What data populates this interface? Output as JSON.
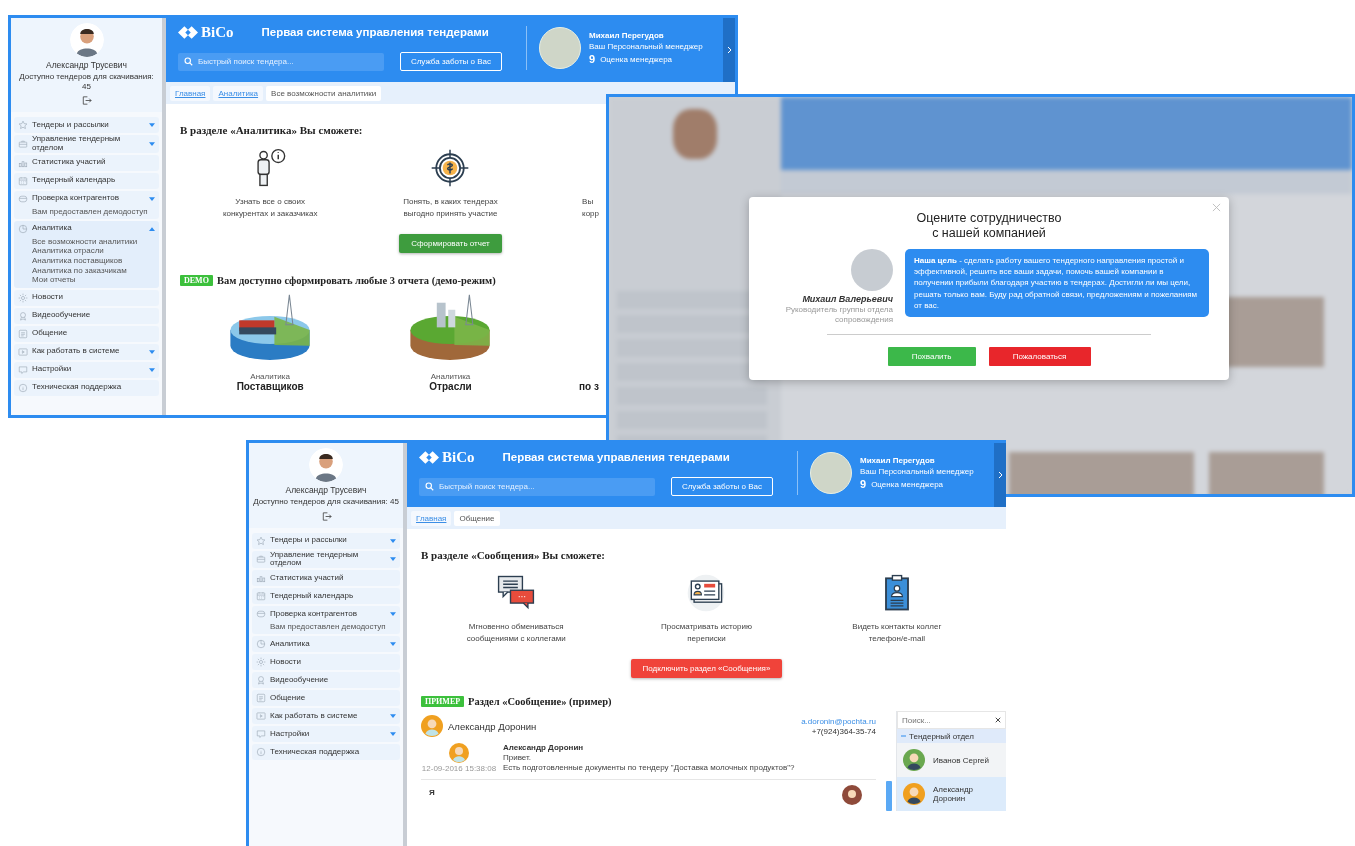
{
  "screens": [
    {
      "kind": "analytics",
      "sidebar": {
        "user_name": "Александр Трусевич",
        "downloads_note": "Доступно тендеров для скачивания: 45",
        "menu": [
          {
            "label": "Тендеры и рассылки",
            "kind": "collapsible",
            "expanded": false
          },
          {
            "label": "Управление тендерным отделом",
            "kind": "collapsible",
            "expanded": false
          },
          {
            "label": "Статистика участий",
            "kind": "plain",
            "expanded": false
          },
          {
            "label": "Тендерный календарь",
            "kind": "plain",
            "expanded": false
          },
          {
            "label": "Проверка контрагентов",
            "kind": "collapsible",
            "expanded": false,
            "note": "Вам предоставлен демодоступ"
          },
          {
            "label": "Аналитика",
            "kind": "collapsible",
            "expanded": true,
            "children": [
              "Все возможности аналитики",
              "Аналитика отрасли",
              "Аналитика поставщиков",
              "Аналитика по заказчикам",
              "Мои отчеты"
            ]
          },
          {
            "label": "Новости",
            "kind": "plain",
            "expanded": false
          },
          {
            "label": "Видеообучение",
            "kind": "plain",
            "expanded": false
          },
          {
            "label": "Общение",
            "kind": "plain",
            "expanded": false
          },
          {
            "label": "Как работать в системе",
            "kind": "collapsible",
            "expanded": false
          },
          {
            "label": "Настройки",
            "kind": "collapsible",
            "expanded": false
          },
          {
            "label": "Техническая поддержка",
            "kind": "plain",
            "expanded": false
          }
        ]
      },
      "header": {
        "logo": "BiCo",
        "title": "Первая система управления тендерами",
        "search": {
          "placeholder": "Быстрый поиск тендера..."
        },
        "care_button": "Служба заботы о Вас",
        "manager": {
          "name": "Михаил Перегудов",
          "role": "Ваш Персональный менеджер",
          "score": "9",
          "score_label": "Оценка менеджера"
        }
      },
      "breadcrumbs": [
        {
          "label": "Главная",
          "selected": false
        },
        {
          "label": "Аналитика",
          "selected": false
        },
        {
          "label": "Все возможности аналитики",
          "selected": true
        }
      ],
      "intro": {
        "heading": "В разделе «Аналитика» Вы сможете:",
        "features": [
          {
            "kind": "full",
            "lines": [
              "Узнать все о своих",
              "конкурентах и заказчиках"
            ]
          },
          {
            "kind": "full",
            "lines": [
              "Понять, в каких тендерах",
              "выгодно принять участие"
            ]
          },
          {
            "kind": "cut",
            "lines": [
              "Вы",
              "корр"
            ]
          }
        ],
        "button": {
          "kind": "green",
          "label": "Сформировать отчет"
        }
      },
      "demo": {
        "badge": "DEMO",
        "heading": "Вам доступно сформировать любые 3 отчета (демо-режим)",
        "reports": [
          {
            "kind": "full",
            "caption": "Аналитика",
            "title": "Поставщиков"
          },
          {
            "kind": "full",
            "caption": "Аналитика",
            "title": "Отрасли"
          },
          {
            "kind": "cut",
            "title": "по з"
          }
        ]
      }
    },
    {
      "kind": "rating",
      "modal": {
        "title_lines": [
          "Оцените сотрудничество",
          "с нашей компанией"
        ],
        "person": {
          "name": "Михаил Валерьевич",
          "role": "Руководитель группы отдела сопровождения"
        },
        "message": "**Наша цель** - сделать работу вашего тендерного направления простой и эффективной, решить все ваши задачи, помочь вашей компании в получении прибыли благодаря участию в тендерах. Достигли ли мы цели, решать только вам. Буду рад обратной связи, предложениям и пожеланиям от вас.",
        "buttons": [
          {
            "kind": "praise",
            "label": "Похвалить"
          },
          {
            "kind": "complain",
            "label": "Пожаловаться"
          }
        ]
      }
    },
    {
      "kind": "messages",
      "sidebar": {
        "user_name": "Александр Трусевич",
        "downloads_note": "Доступно тендеров для скачивания: 45",
        "menu": [
          {
            "label": "Тендеры и рассылки",
            "kind": "collapsible",
            "expanded": false
          },
          {
            "label": "Управление тендерным отделом",
            "kind": "collapsible",
            "expanded": false
          },
          {
            "label": "Статистика участий",
            "kind": "plain",
            "expanded": false
          },
          {
            "label": "Тендерный календарь",
            "kind": "plain",
            "expanded": false
          },
          {
            "label": "Проверка контрагентов",
            "kind": "collapsible",
            "expanded": false,
            "note": "Вам предоставлен демодоступ"
          },
          {
            "label": "Аналитика",
            "kind": "collapsible",
            "expanded": false
          },
          {
            "label": "Новости",
            "kind": "plain",
            "expanded": false
          },
          {
            "label": "Видеообучение",
            "kind": "plain",
            "expanded": false
          },
          {
            "label": "Общение",
            "kind": "plain",
            "expanded": false
          },
          {
            "label": "Как работать в системе",
            "kind": "collapsible",
            "expanded": false
          },
          {
            "label": "Настройки",
            "kind": "collapsible",
            "expanded": false
          },
          {
            "label": "Техническая поддержка",
            "kind": "plain",
            "expanded": false
          }
        ]
      },
      "header": {
        "logo": "BiCo",
        "title": "Первая система управления тендерами",
        "search": {
          "placeholder": "Быстрый поиск тендера..."
        },
        "care_button": "Служба заботы о Вас",
        "manager": {
          "name": "Михаил Перегудов",
          "role": "Ваш Персональный менеджер",
          "score": "9",
          "score_label": "Оценка менеджера"
        }
      },
      "breadcrumbs": [
        {
          "label": "Главная",
          "selected": false
        },
        {
          "label": "Общение",
          "selected": true
        }
      ],
      "intro": {
        "heading": "В разделе «Сообщения» Вы сможете:",
        "features": [
          {
            "kind": "full",
            "lines": [
              "Мгновенно обмениваться",
              "сообщениями с коллегами"
            ]
          },
          {
            "kind": "full",
            "lines": [
              "Просматривать историю",
              "переписки"
            ]
          },
          {
            "kind": "full",
            "lines": [
              "Видеть контакты коллег",
              "телефон/e-mail"
            ]
          }
        ],
        "button": {
          "kind": "red",
          "label": "Подключить раздел «Сообщения»"
        }
      },
      "example": {
        "badge": "ПРИМЕР",
        "heading": "Раздел «Сообщение» (пример)",
        "chat": {
          "contact_name": "Александр Доронин",
          "email": "a.doronin@pochta.ru",
          "phone": "+7(924)364-35-74",
          "message": {
            "author": "Александр Доронин",
            "time": "12-09-2016 15:38:08",
            "lines": [
              "Привет.",
              "Есть подготовленные документы по тендеру \"Доставка молочных продуктов\"?"
            ]
          },
          "reply_author": "Я"
        },
        "contacts": {
          "search": {
            "placeholder": "Поиск..."
          },
          "group": "Тендерный отдел",
          "items": [
            {
              "name": "Иванов Сергей",
              "selected": false,
              "color": "#6aa84f"
            },
            {
              "name": "Александр Доронин",
              "selected": true,
              "color": "#f0a020"
            }
          ]
        }
      }
    }
  ]
}
